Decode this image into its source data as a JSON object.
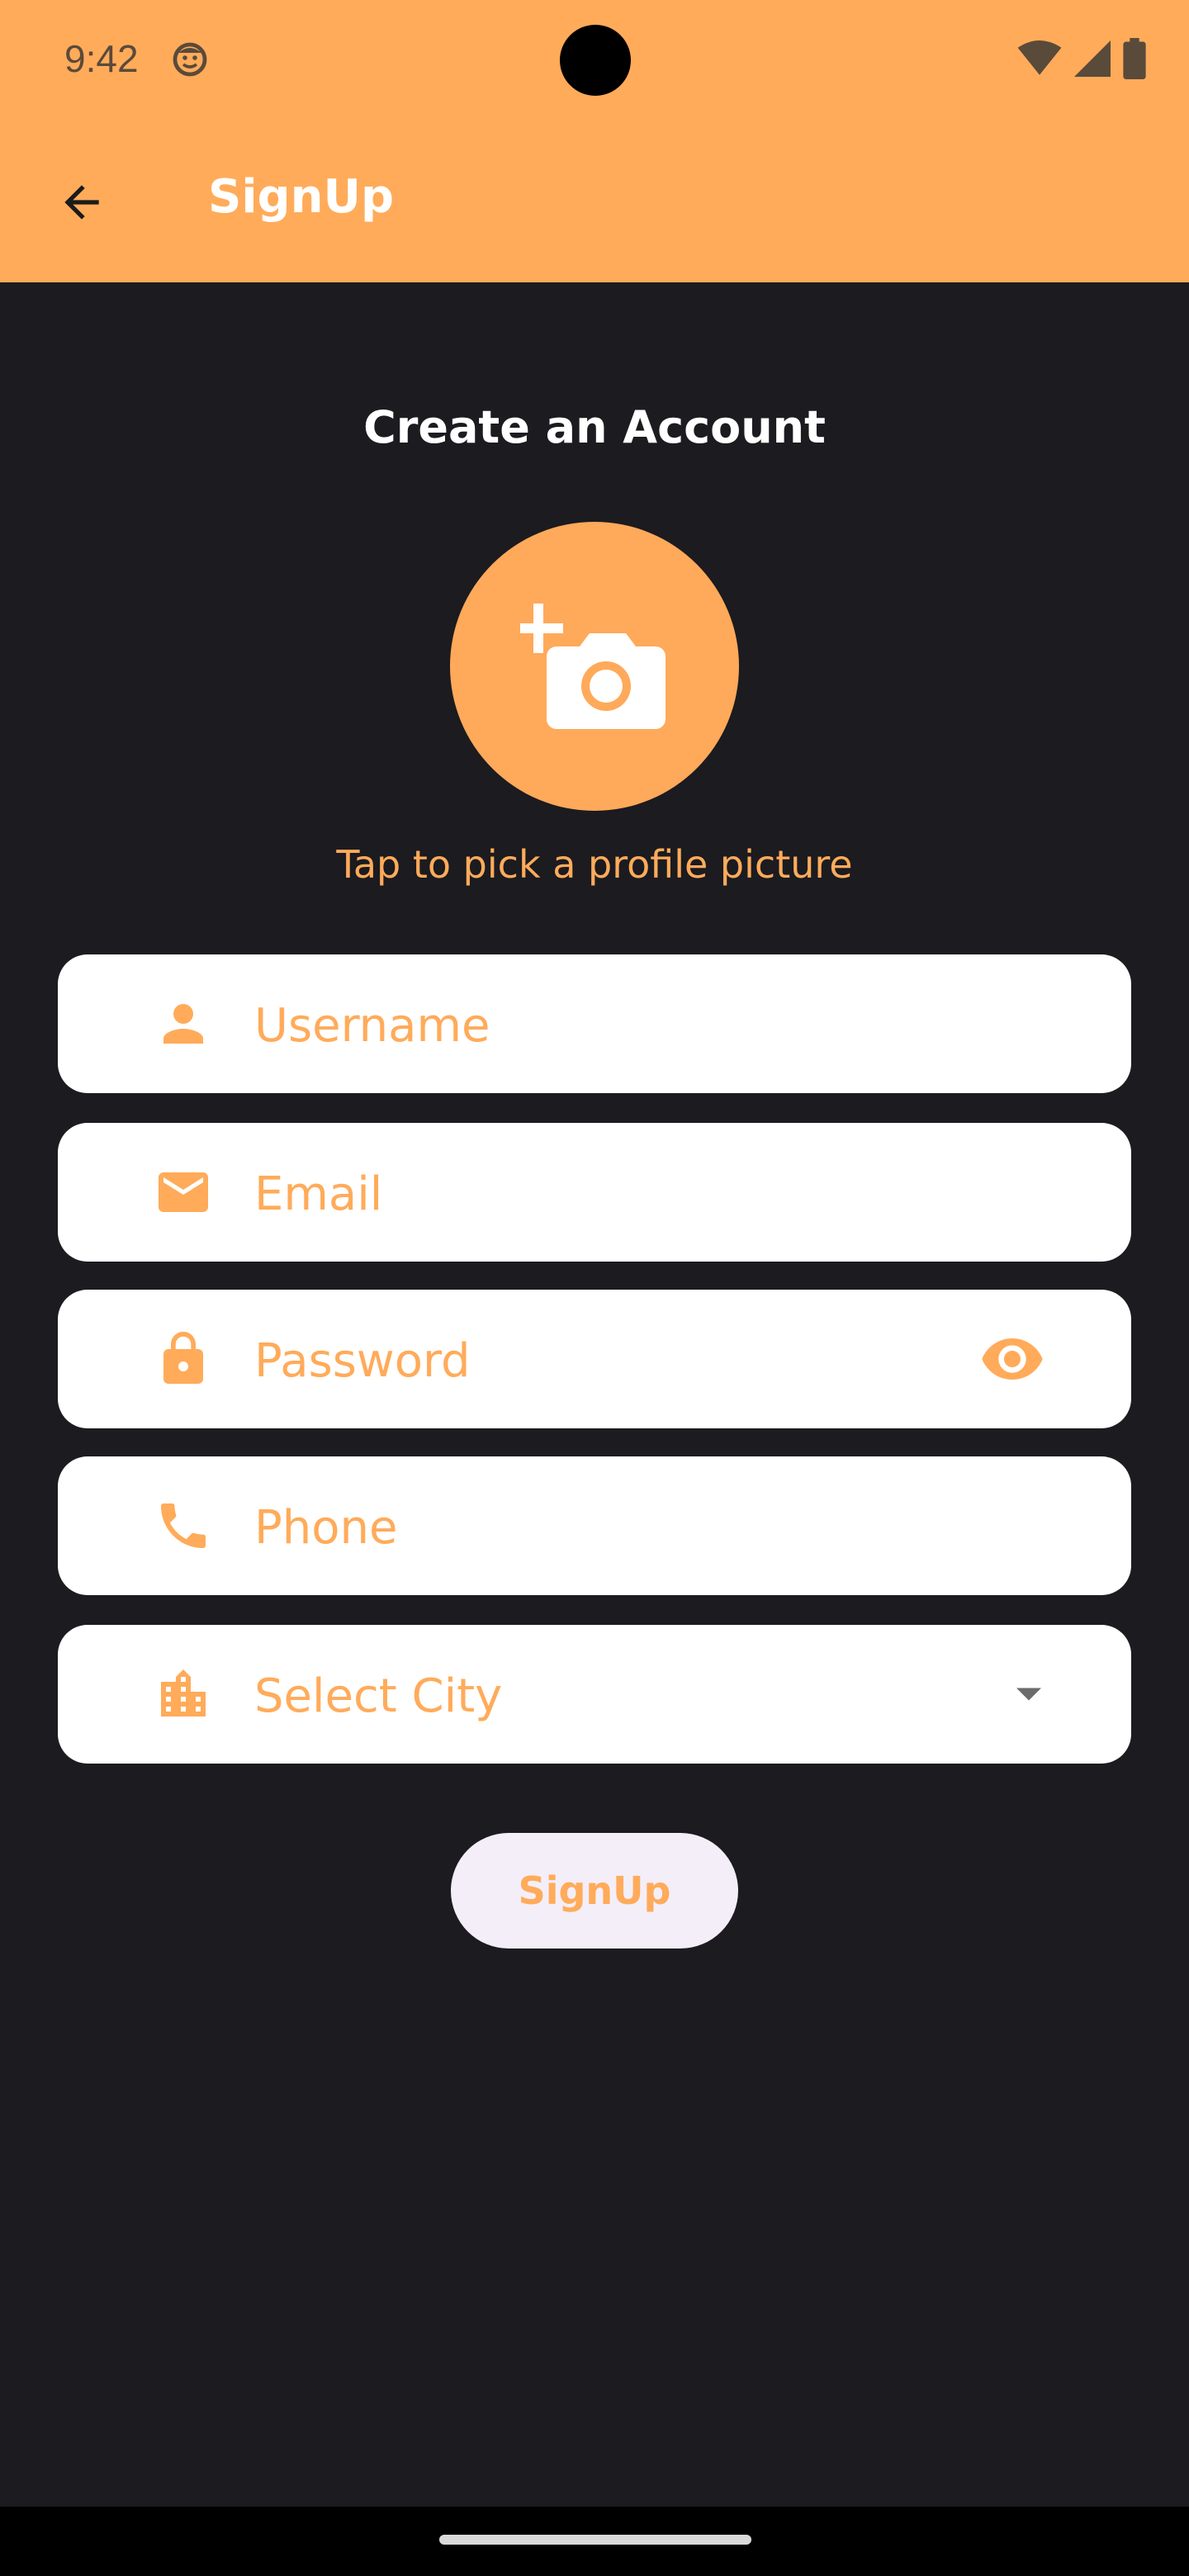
{
  "status_bar": {
    "time": "9:42",
    "icons": [
      "notification-face-icon",
      "wifi-icon",
      "cellular-signal-icon",
      "battery-icon"
    ]
  },
  "app_bar": {
    "title": "SignUp",
    "back_icon": "arrow-back-icon"
  },
  "content": {
    "heading": "Create an Account",
    "avatar_icon": "add-a-photo-icon",
    "avatar_hint": "Tap to pick a profile picture"
  },
  "form": {
    "username": {
      "placeholder": "Username",
      "icon": "person-icon"
    },
    "email": {
      "placeholder": "Email",
      "icon": "mail-icon"
    },
    "password": {
      "placeholder": "Password",
      "icon": "lock-icon",
      "trailing_icon": "eye-icon"
    },
    "phone": {
      "placeholder": "Phone",
      "icon": "phone-icon"
    },
    "city": {
      "placeholder": "Select City",
      "icon": "location-city-icon",
      "trailing_icon": "dropdown-arrow-icon"
    }
  },
  "actions": {
    "signup_label": "SignUp"
  },
  "colors": {
    "accent": "#ffab5a",
    "background": "#1b1b20",
    "field_bg": "#ffffff",
    "button_bg": "#f4eef8"
  }
}
